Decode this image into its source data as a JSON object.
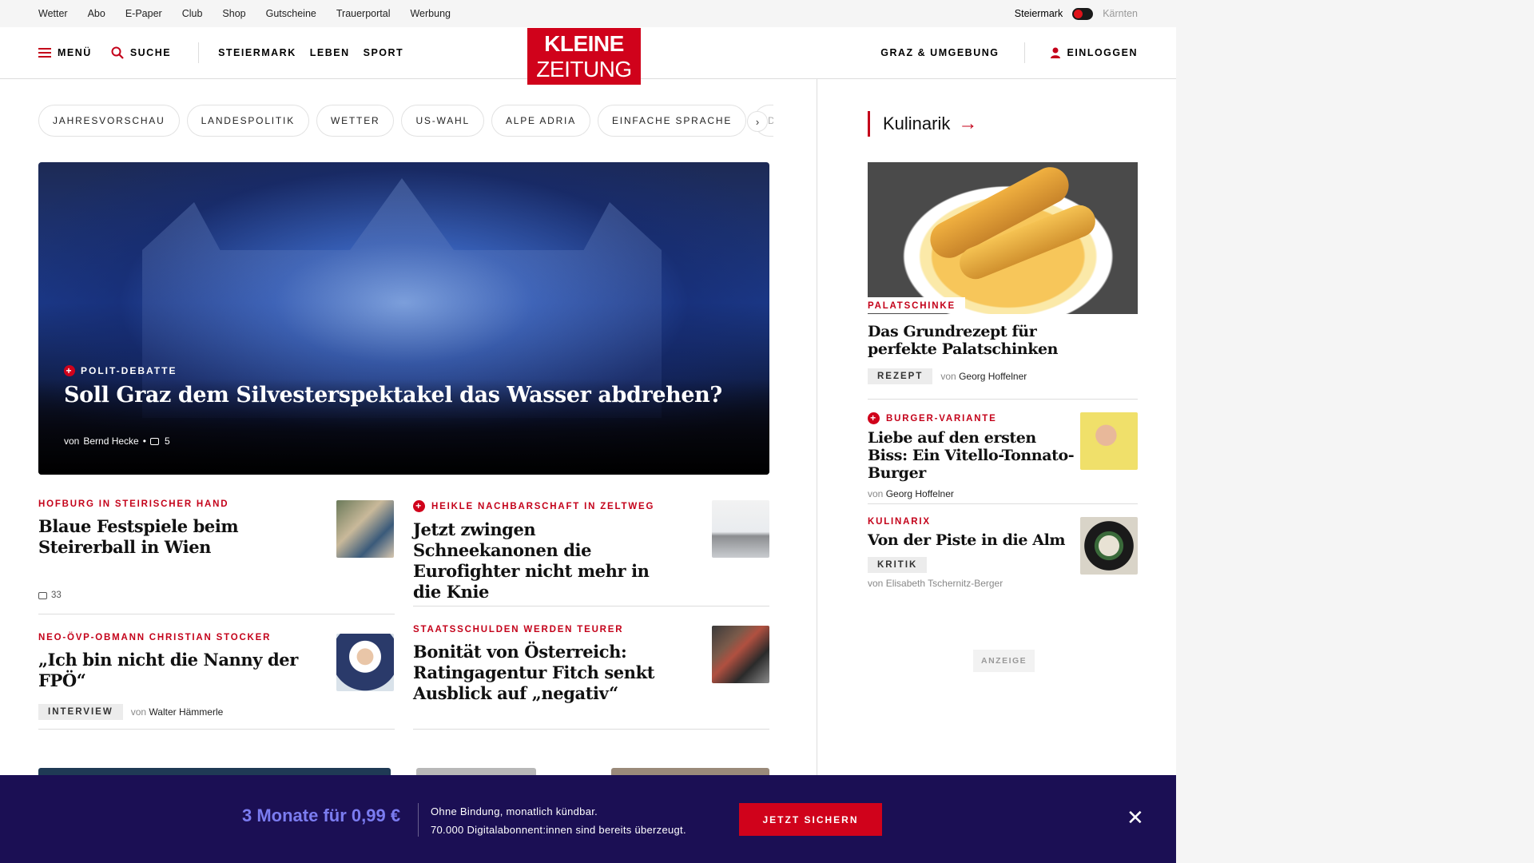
{
  "utility": {
    "links": [
      "Wetter",
      "Abo",
      "E-Paper",
      "Club",
      "Shop",
      "Gutscheine",
      "Trauerportal",
      "Werbung"
    ],
    "region_active": "Steiermark",
    "region_inactive": "Kärnten"
  },
  "header": {
    "menu": "MENÜ",
    "search": "SUCHE",
    "nav": [
      "STEIERMARK",
      "LEBEN",
      "SPORT"
    ],
    "logo_line1": "KLEINE",
    "logo_line2": "ZEITUNG",
    "region_link": "GRAZ & UMGEBUNG",
    "login": "EINLOGGEN"
  },
  "chips": [
    "JAHRESVORSCHAU",
    "LANDESPOLITIK",
    "WETTER",
    "US-WAHL",
    "ALPE ADRIA",
    "EINFACHE SPRACHE",
    "DOS"
  ],
  "hero": {
    "kicker": "POLIT-DEBATTE",
    "title": "Soll Graz dem Silvesterspektakel das Wasser abdrehen?",
    "byline_prefix": "von",
    "author": "Bernd Hecke",
    "comments": "5"
  },
  "articles": [
    {
      "kicker": "HOFBURG IN STEIRISCHER HAND",
      "title": "Blaue Festspiele beim Steirerball in Wien",
      "comments": "33"
    },
    {
      "kicker": "HEIKLE NACHBARSCHAFT IN ZELTWEG",
      "title": "Jetzt zwingen Schneekanonen die Eurofighter nicht mehr in die Knie"
    },
    {
      "kicker": "NEO-ÖVP-OBMANN CHRISTIAN STOCKER",
      "title": "„Ich bin nicht die Nanny der FPÖ“",
      "badge": "INTERVIEW",
      "byline_prefix": "von",
      "author": "Walter Hämmerle"
    },
    {
      "kicker": "STAATSSCHULDEN WERDEN TEURER",
      "title": "Bonität von Österreich: Ratingagentur Fitch senkt Ausblick auf „negativ“"
    }
  ],
  "sidebar": {
    "heading": "Kulinarik",
    "items": [
      {
        "kicker": "PALATSCHINKE",
        "title": "Das Grundrezept für perfekte Palatschinken",
        "badge": "REZEPT",
        "byline_prefix": "von",
        "author": "Georg Hoffelner"
      },
      {
        "kicker": "BURGER-VARIANTE",
        "title": "Liebe auf den ersten Biss: Ein Vitello-Tonnato-Burger",
        "byline_prefix": "von",
        "author": "Georg Hoffelner"
      },
      {
        "kicker": "KULINARIX",
        "title": "Von der Piste in die Alm",
        "badge": "KRITIK",
        "byline_prefix": "von",
        "author": "Elisabeth Tschernitz-Berger"
      }
    ],
    "ad_label": "ANZEIGE"
  },
  "promo": {
    "price": "3 Monate für 0,99 €",
    "line1": "Ohne Bindung, monatlich kündbar.",
    "line2": "70.000 Digitalabonnent:innen sind bereits überzeugt.",
    "cta": "JETZT SICHERN"
  },
  "colors": {
    "brand_red": "#d0021b",
    "promo_bg": "#1b0f54",
    "promo_price": "#7b7cf0"
  }
}
